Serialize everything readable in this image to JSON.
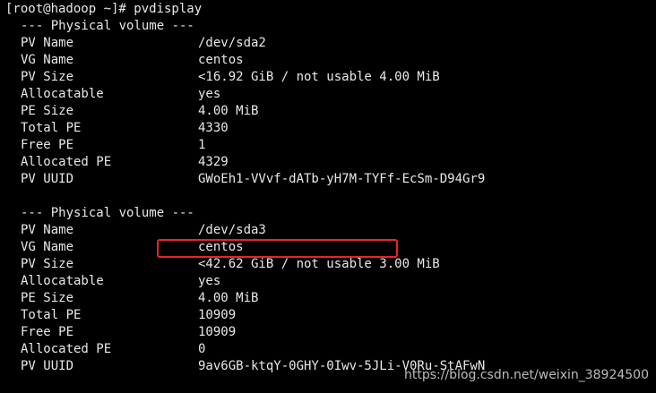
{
  "terminal": {
    "prompt": "[root@hadoop ~]# pvdisplay",
    "volumes": [
      {
        "header": "--- Physical volume ---",
        "fields": [
          {
            "label": "PV Name",
            "value": "/dev/sda2"
          },
          {
            "label": "VG Name",
            "value": "centos"
          },
          {
            "label": "PV Size",
            "value": "<16.92 GiB / not usable 4.00 MiB"
          },
          {
            "label": "Allocatable",
            "value": "yes"
          },
          {
            "label": "PE Size",
            "value": "4.00 MiB"
          },
          {
            "label": "Total PE",
            "value": "4330"
          },
          {
            "label": "Free PE",
            "value": "1"
          },
          {
            "label": "Allocated PE",
            "value": "4329"
          },
          {
            "label": "PV UUID",
            "value": "GWoEh1-VVvf-dATb-yH7M-TYFf-EcSm-D94Gr9"
          }
        ]
      },
      {
        "header": "--- Physical volume ---",
        "fields": [
          {
            "label": "PV Name",
            "value": "/dev/sda3"
          },
          {
            "label": "VG Name",
            "value": "centos"
          },
          {
            "label": "PV Size",
            "value": "<42.62 GiB / not usable 3.00 MiB"
          },
          {
            "label": "Allocatable",
            "value": "yes"
          },
          {
            "label": "PE Size",
            "value": "4.00 MiB"
          },
          {
            "label": "Total PE",
            "value": "10909"
          },
          {
            "label": "Free PE",
            "value": "10909"
          },
          {
            "label": "Allocated PE",
            "value": "0"
          },
          {
            "label": "PV UUID",
            "value": "9av6GB-ktqY-0GHY-0Iwv-5JLi-V0Ru-StAFwN"
          }
        ]
      }
    ]
  },
  "watermark": "https://blog.csdn.net/weixin_38924500",
  "colors": {
    "background": "#000000",
    "text": "#e8e8e8",
    "highlight_border": "#e8242a"
  }
}
